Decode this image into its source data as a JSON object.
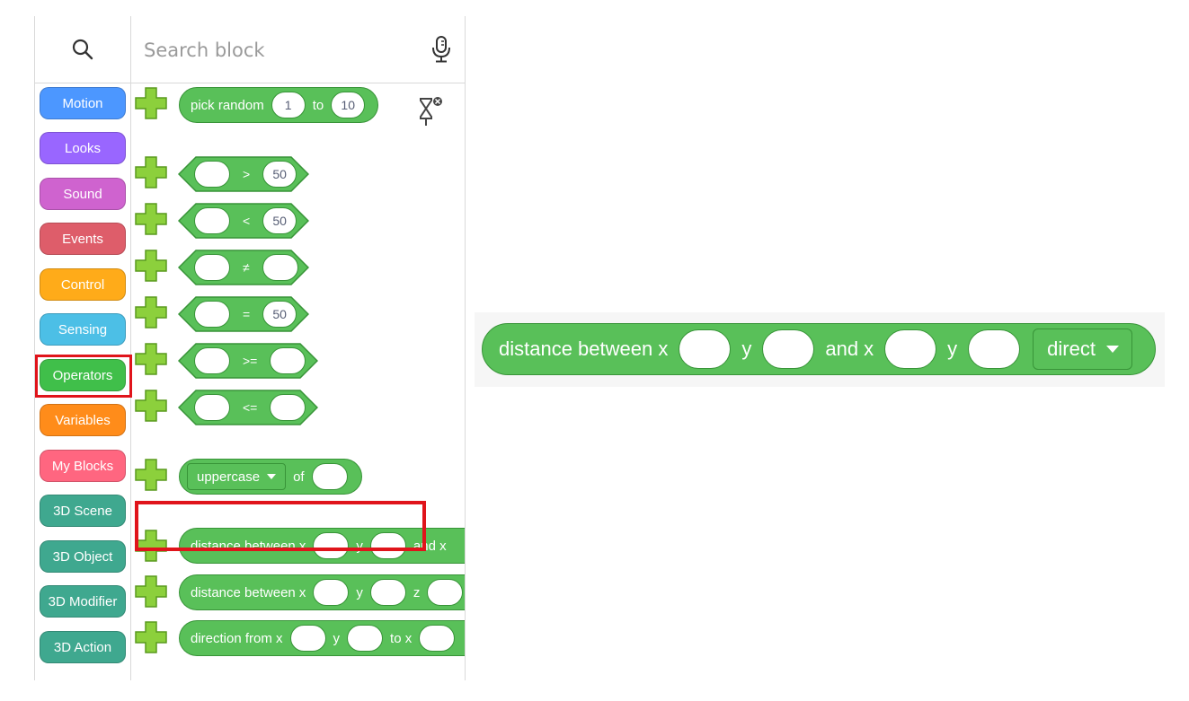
{
  "search": {
    "placeholder": "Search block"
  },
  "categories": [
    {
      "label": "Motion",
      "color": "#4c97ff"
    },
    {
      "label": "Looks",
      "color": "#9966ff"
    },
    {
      "label": "Sound",
      "color": "#cf63cf"
    },
    {
      "label": "Events",
      "color": "#de5d6a"
    },
    {
      "label": "Control",
      "color": "#ffab19"
    },
    {
      "label": "Sensing",
      "color": "#4cbfe6"
    },
    {
      "label": "Operators",
      "color": "#40bf4a"
    },
    {
      "label": "Variables",
      "color": "#ff8c1a"
    },
    {
      "label": "My Blocks",
      "color": "#ff6680"
    },
    {
      "label": "3D Scene",
      "color": "#3fa88f"
    },
    {
      "label": "3D Object",
      "color": "#3fa88f"
    },
    {
      "label": "3D Modifier",
      "color": "#3fa88f"
    },
    {
      "label": "3D Action",
      "color": "#3fa88f"
    }
  ],
  "selected_category": "Operators",
  "blocks": {
    "pick_random": {
      "label": "pick random",
      "from": "1",
      "to_label": "to",
      "to": "10"
    },
    "gt": {
      "op": ">",
      "right": "50"
    },
    "lt": {
      "op": "<",
      "right": "50"
    },
    "neq": {
      "op": "≠"
    },
    "eq": {
      "op": "=",
      "right": "50"
    },
    "gte": {
      "op": ">="
    },
    "lte": {
      "op": "<="
    },
    "case": {
      "dropdown": "uppercase",
      "of_label": "of"
    },
    "distance2d": {
      "label": "distance between x",
      "y_label": "y",
      "and_label": "and x"
    },
    "distance3d": {
      "label": "distance between x",
      "y_label": "y",
      "z_label": "z"
    },
    "direction": {
      "label": "direction from x",
      "y_label": "y",
      "to_label": "to x"
    }
  },
  "zoomed_block": {
    "label": "distance between x",
    "y_label": "y",
    "and_label": "and x",
    "y2_label": "y",
    "dropdown": "direct"
  },
  "colors": {
    "operators_green": "#59c059",
    "highlight_red": "#e0141b"
  }
}
